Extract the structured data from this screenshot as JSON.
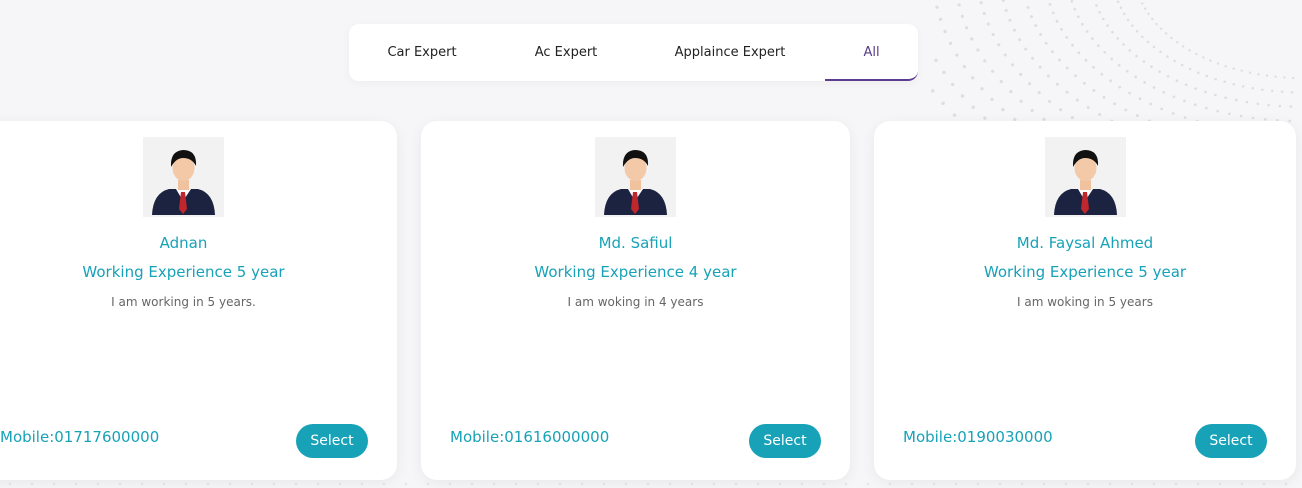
{
  "tabs": [
    {
      "label": "Car Expert",
      "active": false
    },
    {
      "label": "Ac Expert",
      "active": false
    },
    {
      "label": "Applaince Expert",
      "active": false
    },
    {
      "label": "All",
      "active": true
    }
  ],
  "experts": [
    {
      "name": "Adnan",
      "experience": "Working Experience 5 year",
      "description": "I am working in 5 years.",
      "mobile": "Mobile:01717600000",
      "button": "Select"
    },
    {
      "name": "Md. Safiul",
      "experience": "Working Experience 4 year",
      "description": "I am woking in 4 years",
      "mobile": "Mobile:01616000000",
      "button": "Select"
    },
    {
      "name": "Md. Faysal Ahmed",
      "experience": "Working Experience 5 year",
      "description": "I am woking in 5 years",
      "mobile": "Mobile:0190030000",
      "button": "Select"
    }
  ],
  "colors": {
    "accent": "#17a2b8",
    "active_tab": "#5b3e91",
    "background": "#f6f6f8"
  },
  "icons": {
    "avatar": "businessman-avatar-icon"
  }
}
